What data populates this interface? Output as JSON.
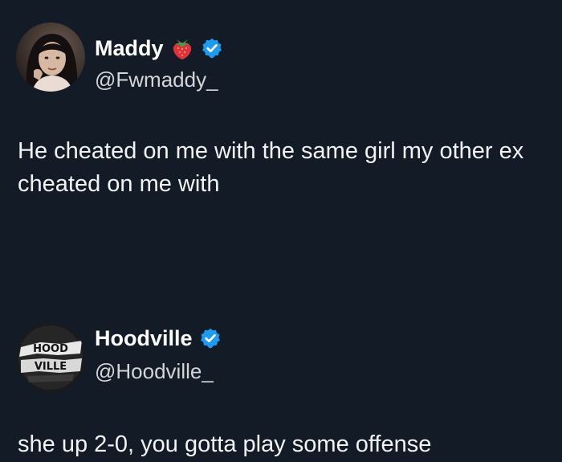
{
  "posts": [
    {
      "display_name": "Maddy",
      "handle": "@Fwmaddy_",
      "text": "He cheated on me with the same girl my other ex cheated on me with",
      "avatar_icon": "profile-photo",
      "name_emoji": "strawberry-icon",
      "verified": true
    },
    {
      "display_name": "Hoodville",
      "handle": "@Hoodville_",
      "text": "she up 2-0, you gotta play some offense",
      "avatar_logo_text": "HOOD VILLE",
      "verified": true
    }
  ],
  "colors": {
    "background": "#131b26",
    "verified_badge": "#1d9bf0",
    "strawberry": "#e0323c"
  }
}
